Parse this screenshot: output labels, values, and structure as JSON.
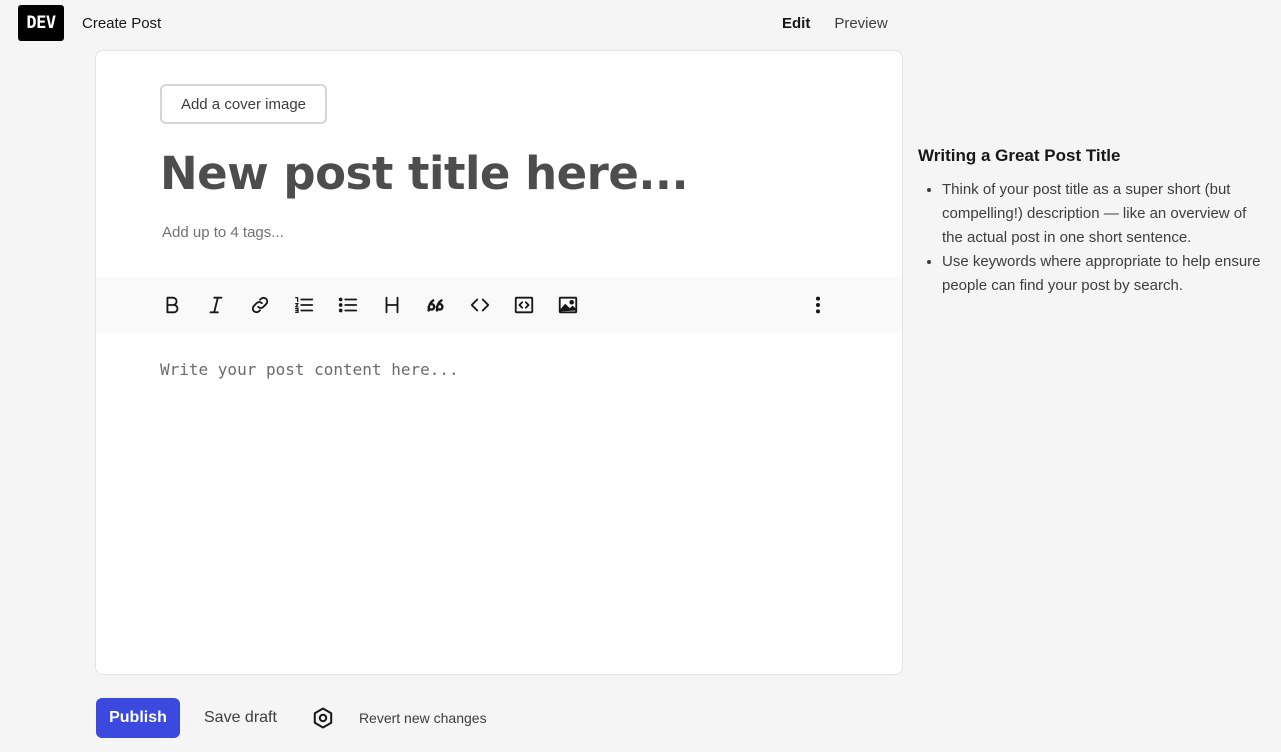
{
  "header": {
    "logo_text": "DEV",
    "page_title": "Create Post",
    "tabs": [
      {
        "label": "Edit",
        "active": true
      },
      {
        "label": "Preview",
        "active": false
      }
    ]
  },
  "editor": {
    "cover_button_label": "Add a cover image",
    "title_placeholder": "New post title here...",
    "tags_placeholder": "Add up to 4 tags...",
    "content_placeholder": "Write your post content here...",
    "toolbar": [
      {
        "name": "bold",
        "icon": "bold-icon"
      },
      {
        "name": "italic",
        "icon": "italic-icon"
      },
      {
        "name": "link",
        "icon": "link-icon"
      },
      {
        "name": "ordered-list",
        "icon": "ordered-list-icon"
      },
      {
        "name": "unordered-list",
        "icon": "unordered-list-icon"
      },
      {
        "name": "heading",
        "icon": "heading-icon"
      },
      {
        "name": "quote",
        "icon": "quote-icon"
      },
      {
        "name": "code",
        "icon": "code-icon"
      },
      {
        "name": "code-block",
        "icon": "code-block-icon"
      },
      {
        "name": "image",
        "icon": "image-icon"
      },
      {
        "name": "more-options",
        "icon": "more-vertical-icon"
      }
    ]
  },
  "help": {
    "title": "Writing a Great Post Title",
    "items": [
      "Think of your post title as a super short (but compelling!) description — like an overview of the actual post in one short sentence.",
      "Use keywords where appropriate to help ensure people can find your post by search."
    ]
  },
  "footer": {
    "publish_label": "Publish",
    "save_draft_label": "Save draft",
    "settings_icon": "settings-hexagon-icon",
    "revert_label": "Revert new changes"
  },
  "colors": {
    "background": "#f5f5f5",
    "accent": "#3b49df",
    "logo_bg": "#000000"
  }
}
